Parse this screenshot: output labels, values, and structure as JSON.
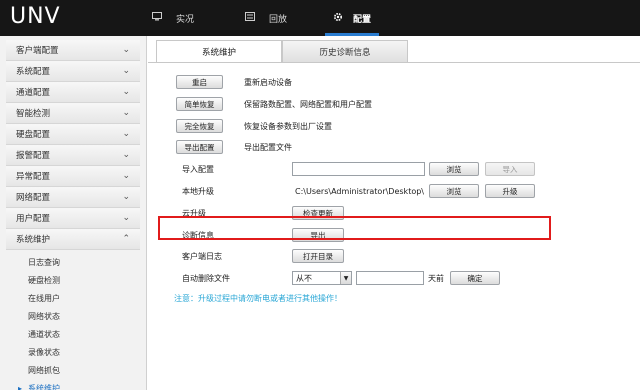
{
  "app": {
    "logo": "UNV"
  },
  "nav": {
    "live": {
      "label": "实况",
      "icon": "monitor-icon"
    },
    "playback": {
      "label": "回放",
      "icon": "playback-icon"
    },
    "config": {
      "label": "配置",
      "icon": "gear-icon"
    }
  },
  "sidebar": {
    "items": [
      {
        "label": "客户端配置"
      },
      {
        "label": "系统配置"
      },
      {
        "label": "通道配置"
      },
      {
        "label": "智能检测"
      },
      {
        "label": "硬盘配置"
      },
      {
        "label": "报警配置"
      },
      {
        "label": "异常配置"
      },
      {
        "label": "网络配置"
      },
      {
        "label": "用户配置"
      },
      {
        "label": "系统维护"
      }
    ],
    "sub_items": [
      {
        "label": "日志查询"
      },
      {
        "label": "硬盘检测"
      },
      {
        "label": "在线用户"
      },
      {
        "label": "网络状态"
      },
      {
        "label": "通道状态"
      },
      {
        "label": "录像状态"
      },
      {
        "label": "网络抓包"
      },
      {
        "label": "系统维护"
      }
    ]
  },
  "tabs": [
    {
      "label": "系统维护"
    },
    {
      "label": "历史诊断信息"
    }
  ],
  "actions": {
    "reboot": {
      "button": "重启",
      "desc": "重新启动设备"
    },
    "simple_restore": {
      "button": "简单恢复",
      "desc": "保留路数配置、网络配置和用户配置"
    },
    "full_restore": {
      "button": "完全恢复",
      "desc": "恢复设备参数到出厂设置"
    },
    "export_config": {
      "button": "导出配置",
      "desc": "导出配置文件"
    }
  },
  "import_config": {
    "label": "导入配置",
    "value": "",
    "browse": "浏览",
    "import": "导入"
  },
  "local_upgrade": {
    "label": "本地升级",
    "value": "C:\\Users\\Administrator\\Desktop\\N",
    "browse": "浏览",
    "upgrade": "升级"
  },
  "cloud_upgrade": {
    "label": "云升级",
    "button": "检查更新"
  },
  "diagnostics": {
    "label": "诊断信息",
    "button": "导出"
  },
  "client_log": {
    "label": "客户端日志",
    "button": "打开目录"
  },
  "auto_delete": {
    "label": "自动删除文件",
    "select_value": "从不",
    "days_value": "",
    "days_unit": "天前",
    "confirm": "确定"
  },
  "notice": "注意：升级过程中请勿断电或者进行其他操作！",
  "colors": {
    "topbar": "#161616",
    "accent": "#2a7dd1",
    "highlight": "#e11b1b",
    "notice": "#2aa7d6"
  }
}
